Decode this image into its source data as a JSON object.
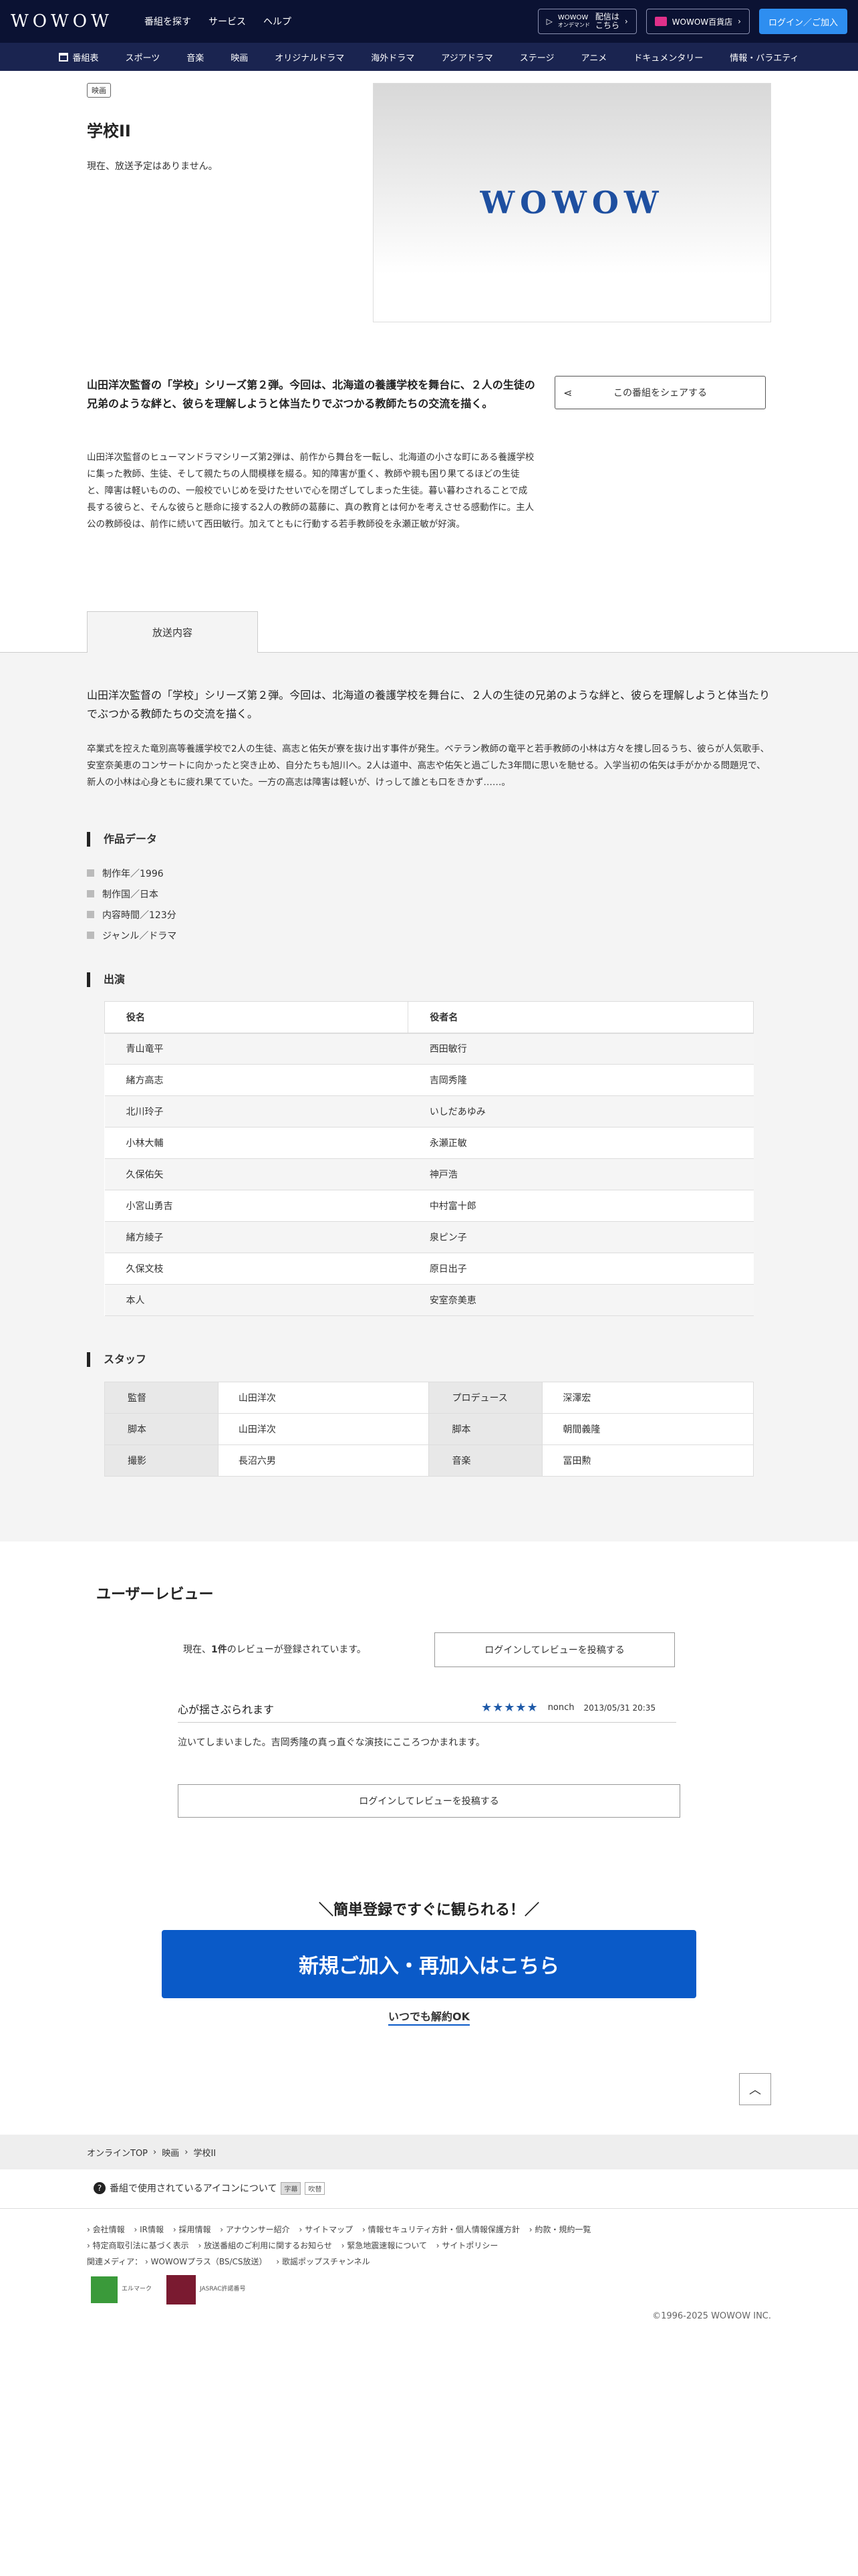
{
  "header": {
    "logo": "WOWOW",
    "nav": [
      "番組を探す",
      "サービス",
      "ヘルプ"
    ],
    "ondemand_brand": "WOWOW",
    "ondemand_tag": "オンデマンド",
    "ondemand_label1": "配信は",
    "ondemand_label2": "こちら",
    "shop_label": "WOWOW百貨店",
    "login_label": "ログイン／ご加入"
  },
  "categories": [
    "番組表",
    "スポーツ",
    "音楽",
    "映画",
    "オリジナルドラマ",
    "海外ドラマ",
    "アジアドラマ",
    "ステージ",
    "アニメ",
    "ドキュメンタリー",
    "情報・バラエティ"
  ],
  "program": {
    "badge": "映画",
    "title": "学校II",
    "no_air": "現在、放送予定はありません。",
    "thumb_logo": "WOWOW",
    "lead": "山田洋次監督の「学校」シリーズ第２弾。今回は、北海道の養護学校を舞台に、２人の生徒の兄弟のような絆と、彼らを理解しようと体当たりでぶつかる教師たちの交流を描く。",
    "description": "山田洋次監督のヒューマンドラマシリーズ第2弾は、前作から舞台を一転し、北海道の小さな町にある養護学校に集った教師、生徒、そして親たちの人間模様を綴る。知的障害が重く、教師や親も困り果てるほどの生徒と、障害は軽いものの、一般校でいじめを受けたせいで心を閉ざしてしまった生徒。暮い暮わされることで成長する彼らと、そんな彼らと懸命に接する2人の教師の葛藤に、真の教育とは何かを考えさせる感動作に。主人公の教師役は、前作に続いて西田敏行。加えてともに行動する若手教師役を永瀬正敏が好演。",
    "share_label": "この番組をシェアする"
  },
  "tab": {
    "label": "放送内容"
  },
  "broadcast": {
    "lead": "山田洋次監督の「学校」シリーズ第２弾。今回は、北海道の養護学校を舞台に、２人の生徒の兄弟のような絆と、彼らを理解しようと体当たりでぶつかる教師たちの交流を描く。",
    "description": "卒業式を控えた竜別高等養護学校で2人の生徒、高志と佑矢が寮を抜け出す事件が発生。ベテラン教師の竜平と若手教師の小林は方々を捜し回るうち、彼らが人気歌手、安室奈美恵のコンサートに向かったと突き止め、自分たちも旭川へ。2人は道中、高志や佑矢と過ごした3年間に思いを馳せる。入学当初の佑矢は手がかかる問題児で、新人の小林は心身ともに疲れ果てていた。一方の高志は障害は軽いが、けっして誰とも口をきかず……。"
  },
  "work_data": {
    "heading": "作品データ",
    "items": [
      "制作年／1996",
      "制作国／日本",
      "内容時間／123分",
      "ジャンル／ドラマ"
    ]
  },
  "cast": {
    "heading": "出演",
    "col_role": "役名",
    "col_actor": "役者名",
    "rows": [
      [
        "青山竜平",
        "西田敏行"
      ],
      [
        "緒方高志",
        "吉岡秀隆"
      ],
      [
        "北川玲子",
        "いしだあゆみ"
      ],
      [
        "小林大輔",
        "永瀬正敏"
      ],
      [
        "久保佑矢",
        "神戸浩"
      ],
      [
        "小宮山勇吉",
        "中村富十郎"
      ],
      [
        "緒方綾子",
        "泉ピン子"
      ],
      [
        "久保文枝",
        "原日出子"
      ],
      [
        "本人",
        "安室奈美恵"
      ]
    ]
  },
  "staff": {
    "heading": "スタッフ",
    "rows": [
      [
        "監督",
        "山田洋次",
        "プロデュース",
        "深澤宏"
      ],
      [
        "脚本",
        "山田洋次",
        "脚本",
        "朝間義隆"
      ],
      [
        "撮影",
        "長沼六男",
        "音楽",
        "冨田勲"
      ]
    ]
  },
  "reviews": {
    "heading": "ユーザーレビュー",
    "count_prefix": "現在、",
    "count": "1件",
    "count_suffix": "のレビューが登録されています。",
    "post_label": "ログインしてレビューを投稿する",
    "item": {
      "title": "心が揺さぶられます",
      "stars": "★★★★★",
      "user": "nonch",
      "date": "2013/05/31 20:35",
      "body": "泣いてしまいました。吉岡秀隆の真っ直ぐな演技にこころつかまれます。"
    }
  },
  "cta": {
    "heading": "＼簡単登録ですぐに観られる！／",
    "button": "新規ご加入・再加入はこちら",
    "sub": "いつでも解約OK"
  },
  "breadcrumb": [
    "オンラインTOP",
    "映画",
    "学校II"
  ],
  "icon_note": {
    "text": "番組で使用されているアイコンについて",
    "chip1": "字幕",
    "chip2": "吹替"
  },
  "footer": {
    "links": [
      "会社情報",
      "IR情報",
      "採用情報",
      "アナウンサー紹介",
      "サイトマップ",
      "情報セキュリティ方針・個人情報保護方針",
      "約款・規約一覧",
      "特定商取引法に基づく表示",
      "放送番組のご利用に関するお知らせ",
      "緊急地震速報について",
      "サイトポリシー",
      "関連メディア：",
      "WOWOWプラス（BS/CS放送）",
      "歌謡ポップスチャンネル"
    ],
    "mark1": "エルマーク",
    "mark2": "JASRAC許諾番号",
    "copyright": "©1996-2025 WOWOW INC."
  }
}
